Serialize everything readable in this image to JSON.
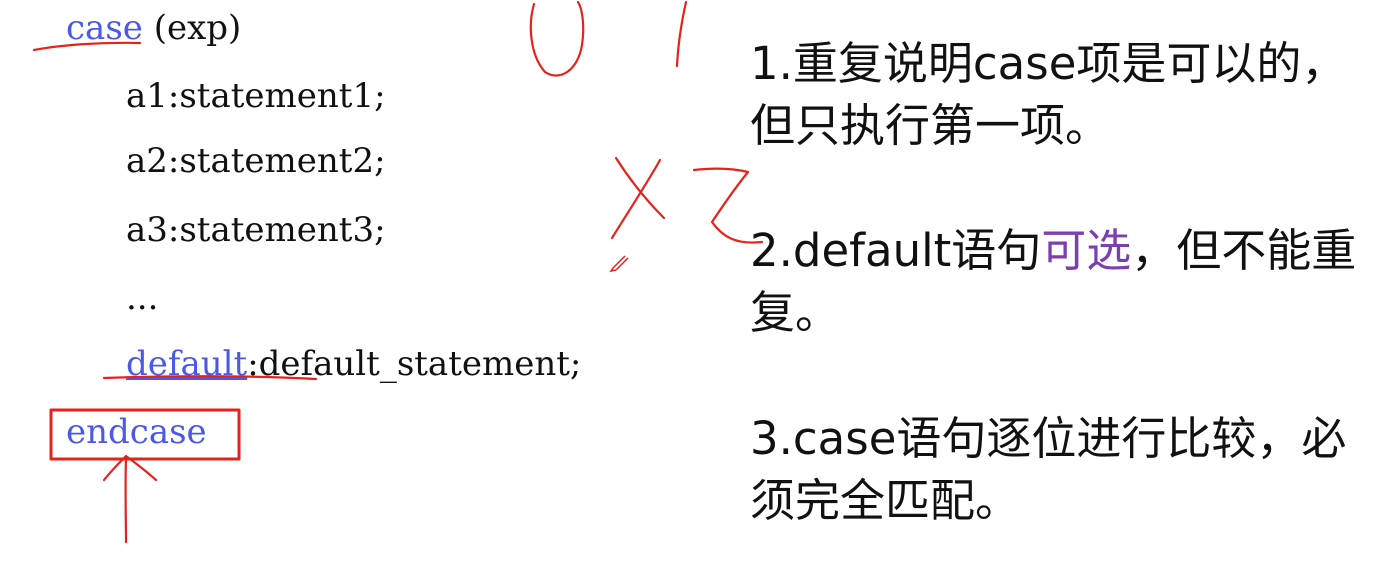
{
  "code": {
    "case_kw": "case",
    "case_rest": " (exp)",
    "items": [
      "a1:statement1;",
      "a2:statement2;",
      "a3:statement3;",
      "..."
    ],
    "default_kw": "default",
    "default_rest": ":default_statement;",
    "endcase_kw": "endcase"
  },
  "annotations": {
    "handwritten": [
      "0",
      "1",
      "X",
      "Z"
    ],
    "ink_color": "#e8211b"
  },
  "notes": {
    "n1": "1.重复说明case项是可以的，但只执行第一项。",
    "n2_before": "2.default语句",
    "n2_highlight": "可选",
    "n2_after": "，但不能重复。",
    "n3": "3.case语句逐位进行比较，必须完全匹配。"
  },
  "colors": {
    "keyword": "#4a59e8",
    "highlight": "#7a3fb0",
    "text": "#111111"
  }
}
